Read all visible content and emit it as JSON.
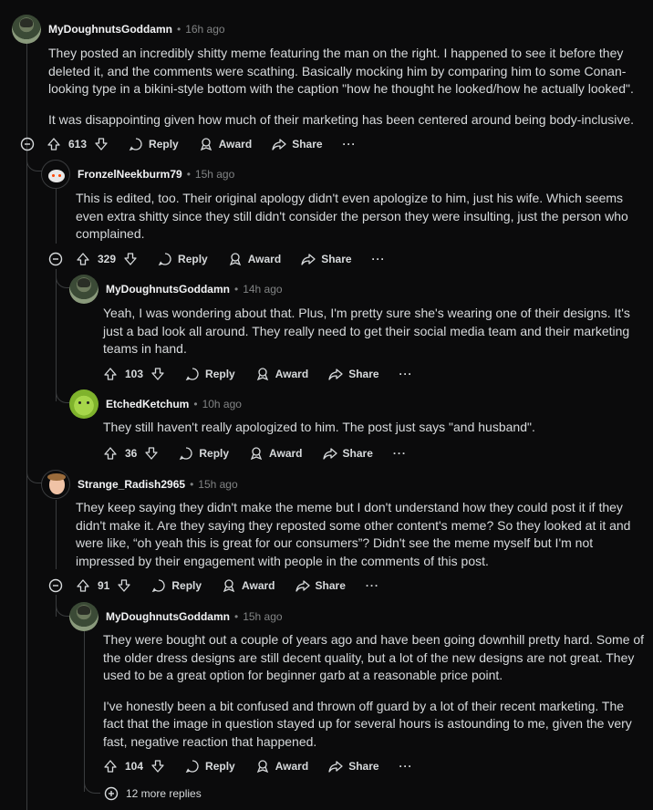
{
  "icons": {
    "upvote": "arrow-up-icon",
    "downvote": "arrow-down-icon",
    "reply": "speech-bubble-icon",
    "award": "award-icon",
    "share": "share-arrow-icon",
    "more": "ellipsis-icon",
    "collapse": "minus-circle-icon",
    "expand": "plus-circle-icon"
  },
  "labels": {
    "reply": "Reply",
    "award": "Award",
    "share": "Share",
    "more": "···"
  },
  "comments": [
    {
      "author": "MyDoughnutsGoddamn",
      "time": "16h ago",
      "paragraphs": [
        "They posted an incredibly shitty meme featuring the man on the right. I happened to see it before they deleted it, and the comments were scathing. Basically mocking him by comparing him to some Conan-looking type in a bikini-style bottom with the caption \"how he thought he looked/how he actually looked\".",
        "It was disappointing given how much of their marketing has been centered around being body-inclusive."
      ],
      "score": "613"
    },
    {
      "author": "FronzelNeekburm79",
      "time": "15h ago",
      "paragraphs": [
        "This is edited, too. Their original apology didn't even apologize to him, just his wife. Which seems even extra shitty since they still didn't consider the person they were insulting, just the person who complained."
      ],
      "score": "329"
    },
    {
      "author": "MyDoughnutsGoddamn",
      "time": "14h ago",
      "paragraphs": [
        "Yeah, I was wondering about that. Plus, I'm pretty sure she's wearing one of their designs. It's just a bad look all around. They really need to get their social media team and their marketing teams in hand."
      ],
      "score": "103"
    },
    {
      "author": "EtchedKetchum",
      "time": "10h ago",
      "paragraphs": [
        "They still haven't really apologized to him. The post just says \"and husband\"."
      ],
      "score": "36"
    },
    {
      "author": "Strange_Radish2965",
      "time": "15h ago",
      "paragraphs": [
        "They keep saying they didn't make the meme but I don't understand how they could post it if they didn't make it. Are they saying they reposted some other content's meme? So they looked at it and were like, “oh yeah this is great for our consumers”? Didn't see the meme myself but I'm not impressed by their engagement with people in the comments of this post."
      ],
      "score": "91"
    },
    {
      "author": "MyDoughnutsGoddamn",
      "time": "15h ago",
      "paragraphs": [
        "They were bought out a couple of years ago and have been going downhill pretty hard. Some of the older dress designs are still decent quality, but a lot of the new designs are not great. They used to be a great option for beginner garb at a reasonable price point.",
        "I've honestly been a bit confused and thrown off guard by a lot of their recent marketing. The fact that the image in question stayed up for several hours is astounding to me, given the very fast, negative reaction that happened."
      ],
      "score": "104"
    }
  ],
  "more_replies": "12 more replies"
}
